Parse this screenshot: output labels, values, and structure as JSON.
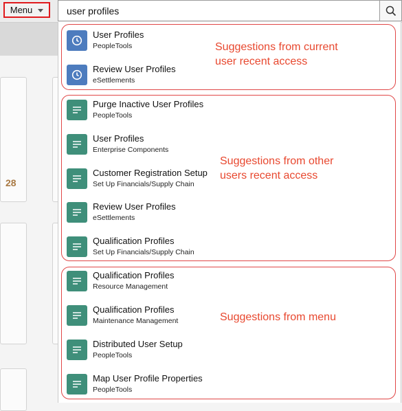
{
  "header": {
    "menu_label": "Menu",
    "search_value": "user profiles"
  },
  "background": {
    "tile_number": "28"
  },
  "groups": [
    {
      "note_lines": [
        "Suggestions from current",
        "user recent access"
      ],
      "icon": "clock-icon",
      "items": [
        {
          "title": "User Profiles",
          "subtitle": "PeopleTools"
        },
        {
          "title": "Review User Profiles",
          "subtitle": "eSettlements"
        }
      ]
    },
    {
      "note_lines": [
        "Suggestions from other",
        "users recent access"
      ],
      "icon": "lines-icon",
      "items": [
        {
          "title": "Purge Inactive User Profiles",
          "subtitle": "PeopleTools"
        },
        {
          "title": "User Profiles",
          "subtitle": "Enterprise Components"
        },
        {
          "title": "Customer Registration Setup",
          "subtitle": "Set Up Financials/Supply Chain"
        },
        {
          "title": "Review User Profiles",
          "subtitle": "eSettlements"
        },
        {
          "title": "Qualification Profiles",
          "subtitle": "Set Up Financials/Supply Chain"
        }
      ]
    },
    {
      "note_lines": [
        "Suggestions from menu"
      ],
      "icon": "lines-icon",
      "items": [
        {
          "title": "Qualification Profiles",
          "subtitle": "Resource Management"
        },
        {
          "title": "Qualification Profiles",
          "subtitle": "Maintenance Management"
        },
        {
          "title": "Distributed User Setup",
          "subtitle": "PeopleTools"
        },
        {
          "title": "Map User Profile Properties",
          "subtitle": "PeopleTools"
        }
      ]
    }
  ],
  "colors": {
    "recent_icon_bg": "#4d7cbe",
    "menu_icon_bg": "#3f8f7a",
    "annotation": "#e8482f"
  }
}
